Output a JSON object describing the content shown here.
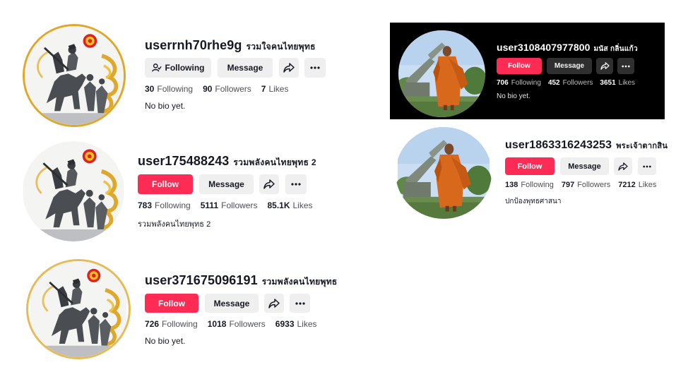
{
  "profiles": [
    {
      "username": "userrnh70rhe9g",
      "nickname": "รวมใจคนไทยพุทธ",
      "primary_button": "Following",
      "message_button": "Message",
      "following": "30",
      "followers": "90",
      "likes": "7",
      "following_label": "Following",
      "followers_label": "Followers",
      "likes_label": "Likes",
      "bio": "No bio yet."
    },
    {
      "username": "user175488243",
      "nickname": "รวมพลังคนไทยพุทธ 2",
      "primary_button": "Follow",
      "message_button": "Message",
      "following": "783",
      "followers": "5111",
      "likes": "85.1K",
      "following_label": "Following",
      "followers_label": "Followers",
      "likes_label": "Likes",
      "bio": "รวมพลังคนไทยพุทธ 2"
    },
    {
      "username": "user371675096191",
      "nickname": "รวมพลังคนไทยพุทธ",
      "primary_button": "Follow",
      "message_button": "Message",
      "following": "726",
      "followers": "1018",
      "likes": "6933",
      "following_label": "Following",
      "followers_label": "Followers",
      "likes_label": "Likes",
      "bio": "No bio yet."
    },
    {
      "username": "user3108407977800",
      "nickname": "มนัส กลิ่นแก้ว",
      "primary_button": "Follow",
      "message_button": "Message",
      "following": "706",
      "followers": "452",
      "likes": "3651",
      "following_label": "Following",
      "followers_label": "Followers",
      "likes_label": "Likes",
      "bio": "No bio yet."
    },
    {
      "username": "user1863316243253",
      "nickname": "พระเจ้าตากสิน",
      "primary_button": "Follow",
      "message_button": "Message",
      "following": "138",
      "followers": "797",
      "likes": "7212",
      "following_label": "Following",
      "followers_label": "Followers",
      "likes_label": "Likes",
      "bio": "ปกป้องพุทธศาสนา"
    }
  ],
  "colors": {
    "follow": "#fe2c55",
    "gold": "#e0a82a",
    "robe": "#d8681c"
  },
  "icons": [
    "user-check-icon",
    "share-icon",
    "more-icon",
    "statue-avatar",
    "monk-avatar"
  ]
}
